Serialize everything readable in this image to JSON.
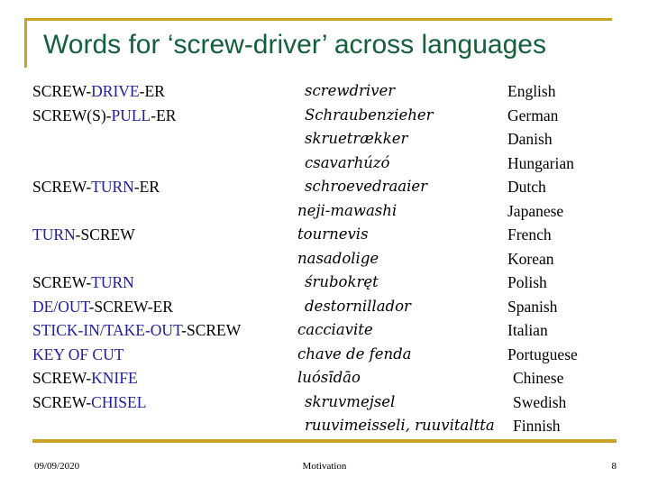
{
  "slide": {
    "title": "Words for ‘screw-driver’ across languages",
    "accent_gold": "#c9a227",
    "title_green": "#15603c",
    "highlight_blue": "#21209c",
    "text_black": "#000000"
  },
  "columns": {
    "morphology_header": "",
    "word_header": "",
    "language_header": ""
  },
  "rows": [
    {
      "morph_parts": [
        {
          "text": "SCREW-",
          "highlight": false
        },
        {
          "text": "DRIVE",
          "highlight": true
        },
        {
          "text": "-ER",
          "highlight": false
        }
      ],
      "word": "screwdriver",
      "language": "English",
      "word_indent": true,
      "lang_indent": false
    },
    {
      "morph_parts": [
        {
          "text": "SCREW(S)-",
          "highlight": false
        },
        {
          "text": "PULL",
          "highlight": true
        },
        {
          "text": "-ER",
          "highlight": false
        }
      ],
      "word": "Schraubenzieher",
      "language": "German",
      "word_indent": true,
      "lang_indent": false
    },
    {
      "morph_parts": [],
      "word": "skruetrækker",
      "language": "Danish",
      "word_indent": true,
      "lang_indent": false
    },
    {
      "morph_parts": [],
      "word": "csavarhúzó",
      "language": "Hungarian",
      "word_indent": true,
      "lang_indent": false
    },
    {
      "morph_parts": [
        {
          "text": "SCREW-",
          "highlight": false
        },
        {
          "text": "TURN",
          "highlight": true
        },
        {
          "text": "-ER",
          "highlight": false
        }
      ],
      "word": "schroevedraaier",
      "language": "Dutch",
      "word_indent": true,
      "lang_indent": false
    },
    {
      "morph_parts": [],
      "word": "neji-mawashi",
      "language": "Japanese",
      "word_indent": false,
      "lang_indent": false
    },
    {
      "morph_parts": [
        {
          "text": "TURN",
          "highlight": true
        },
        {
          "text": "-SCREW",
          "highlight": false
        }
      ],
      "word": "tournevis",
      "language": "French",
      "word_indent": false,
      "lang_indent": false
    },
    {
      "morph_parts": [],
      "word": "nasadolige",
      "language": "Korean",
      "word_indent": false,
      "lang_indent": false
    },
    {
      "morph_parts": [
        {
          "text": "SCREW-",
          "highlight": false
        },
        {
          "text": "TURN",
          "highlight": true
        }
      ],
      "word": "śrubokręt",
      "language": "Polish",
      "word_indent": true,
      "lang_indent": false
    },
    {
      "morph_parts": [
        {
          "text": "DE/OUT",
          "highlight": true
        },
        {
          "text": "-SCREW-ER",
          "highlight": false
        }
      ],
      "word": "destornillador",
      "language": "Spanish",
      "word_indent": true,
      "lang_indent": false
    },
    {
      "morph_parts": [
        {
          "text": "STICK-IN/TAKE-OUT",
          "highlight": true
        },
        {
          "text": "-SCREW",
          "highlight": false
        }
      ],
      "word": "cacciavite",
      "language": "Italian",
      "word_indent": false,
      "lang_indent": false
    },
    {
      "morph_parts": [
        {
          "text": "KEY OF CUT",
          "highlight": true
        }
      ],
      "word": "chave de fenda",
      "language": "Portuguese",
      "word_indent": false,
      "lang_indent": false
    },
    {
      "morph_parts": [
        {
          "text": "SCREW-",
          "highlight": false
        },
        {
          "text": "KNIFE",
          "highlight": true
        }
      ],
      "word": "luósīdāo",
      "language": "Chinese",
      "word_indent": false,
      "lang_indent": true
    },
    {
      "morph_parts": [
        {
          "text": "SCREW-",
          "highlight": false
        },
        {
          "text": "CHISEL",
          "highlight": true
        }
      ],
      "word": "skruvmejsel",
      "language": "Swedish",
      "word_indent": true,
      "lang_indent": true
    },
    {
      "morph_parts": [],
      "word": "ruuvimeisseli, ruuvitaltta",
      "language": "Finnish",
      "word_indent": true,
      "lang_indent": true
    }
  ],
  "footer": {
    "date": "09/09/2020",
    "section": "Motivation",
    "page_number": "8"
  }
}
